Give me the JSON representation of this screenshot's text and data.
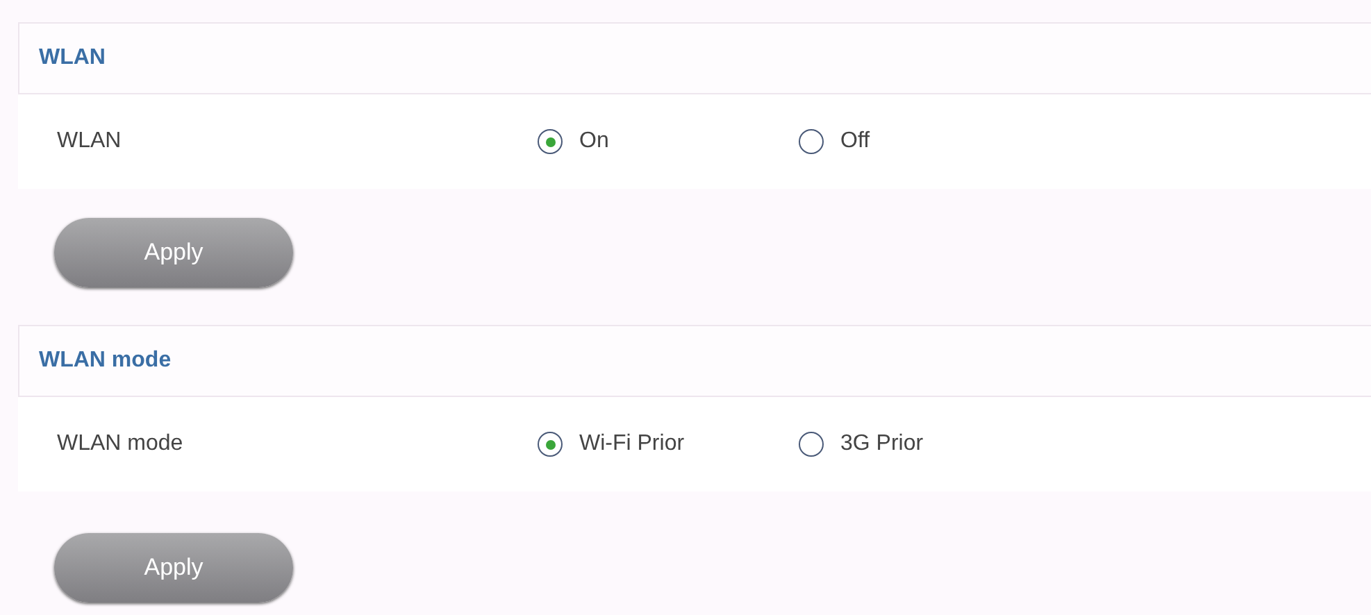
{
  "sections": [
    {
      "title": "WLAN",
      "field": {
        "label": "WLAN",
        "options": [
          {
            "label": "On",
            "selected": true
          },
          {
            "label": "Off",
            "selected": false
          }
        ]
      },
      "button": "Apply"
    },
    {
      "title": "WLAN mode",
      "field": {
        "label": "WLAN mode",
        "options": [
          {
            "label": "Wi-Fi Prior",
            "selected": true
          },
          {
            "label": "3G Prior",
            "selected": false
          }
        ]
      },
      "button": "Apply"
    }
  ]
}
